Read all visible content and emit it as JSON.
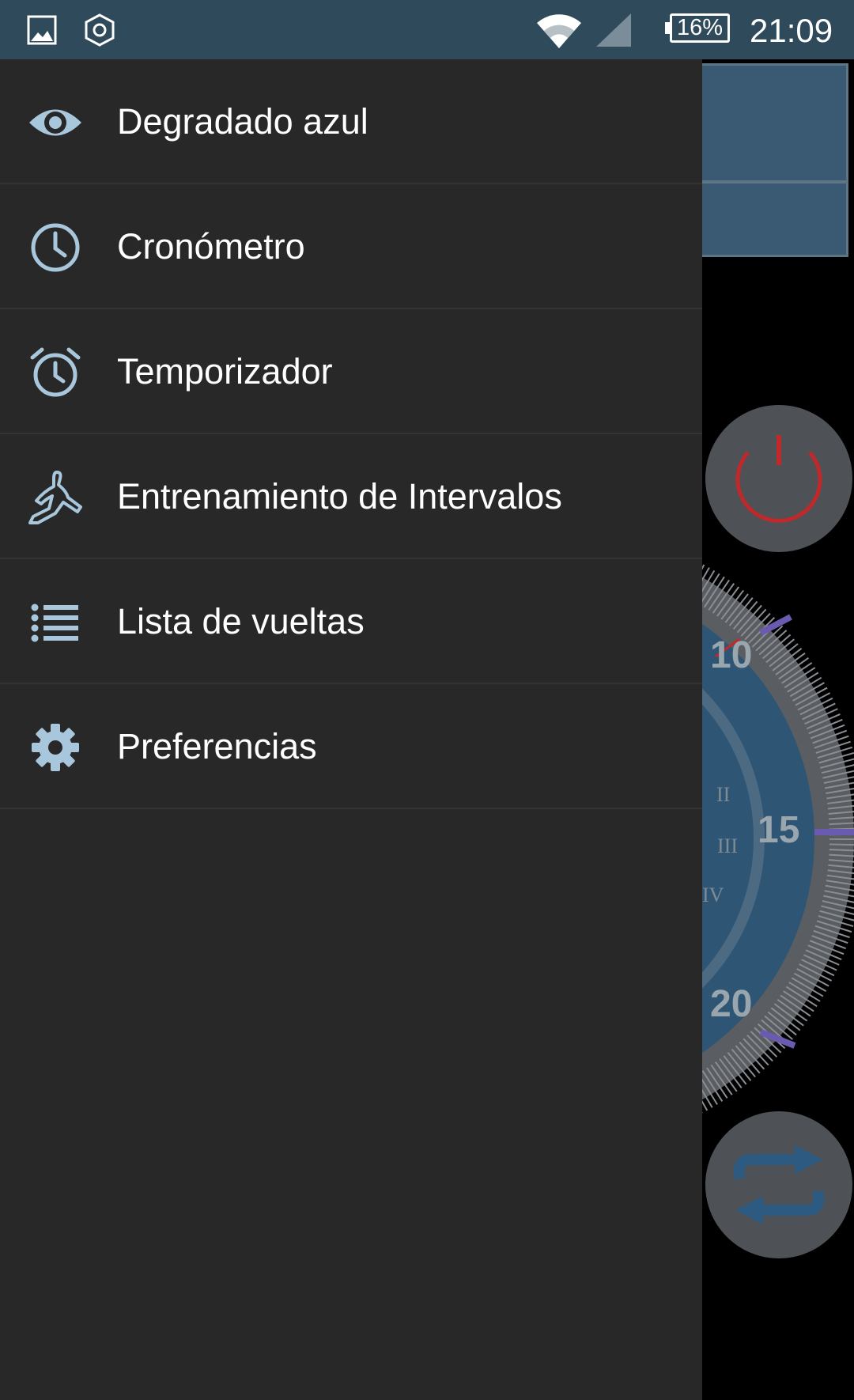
{
  "status_bar": {
    "icons": [
      "gallery-icon",
      "app-hexagon-icon",
      "wifi-icon",
      "cell-signal-icon"
    ],
    "battery": "16%",
    "time": "21:09"
  },
  "drawer": {
    "items": [
      {
        "label": "Degradado azul",
        "icon": "eye-icon"
      },
      {
        "label": "Cronómetro",
        "icon": "clock-icon"
      },
      {
        "label": "Temporizador",
        "icon": "alarm-clock-icon"
      },
      {
        "label": "Entrenamiento de Intervalos",
        "icon": "runner-icon"
      },
      {
        "label": "Lista de vueltas",
        "icon": "list-icon"
      },
      {
        "label": "Preferencias",
        "icon": "gear-icon"
      }
    ]
  },
  "background": {
    "dial_numbers": [
      "10",
      "15",
      "20"
    ],
    "roman_numerals": [
      "II",
      "III",
      "IV"
    ],
    "icons": [
      "power-icon",
      "repeat-icon"
    ]
  },
  "colors": {
    "status_bar": "#2f4a5a",
    "drawer": "#282828",
    "icon": "#a9c7dc",
    "power": "#c0282a"
  }
}
